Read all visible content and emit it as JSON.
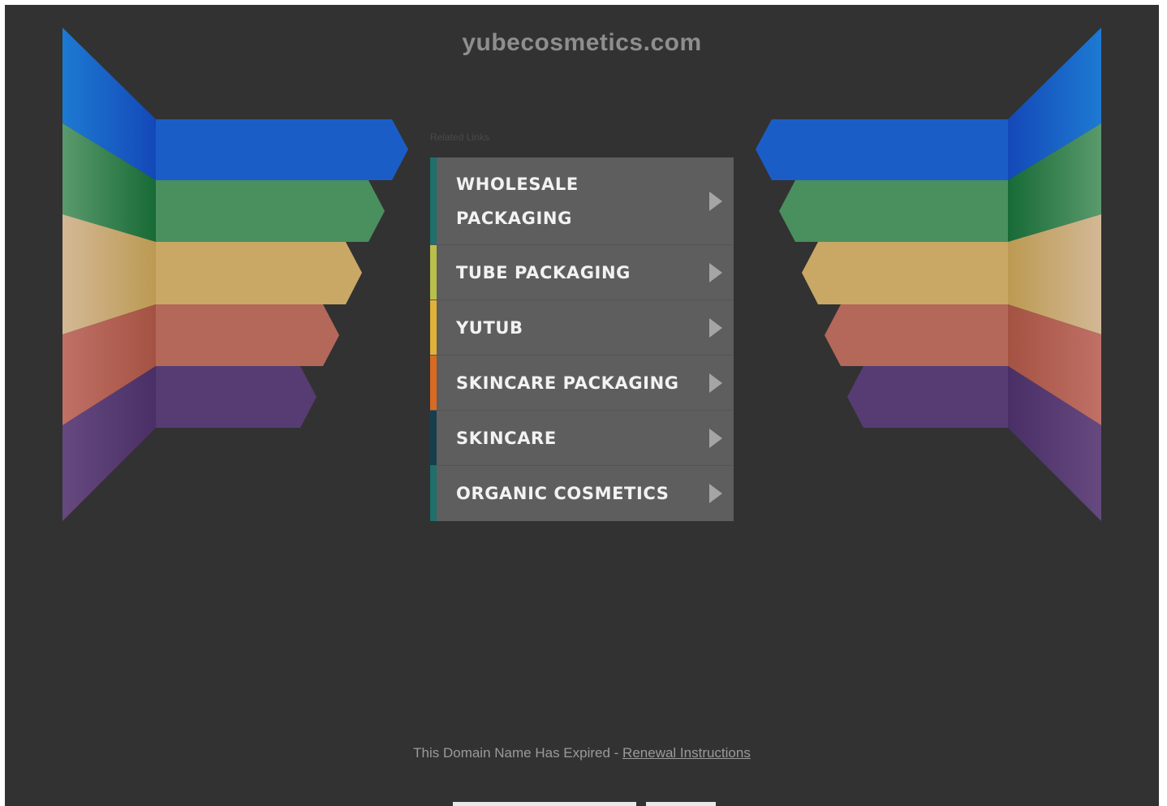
{
  "site": {
    "domain": "yubecosmetics.com"
  },
  "related": {
    "label": "Related Links"
  },
  "menu": {
    "items": [
      {
        "label_line1": "WHOLESALE",
        "label_line2": "PACKAGING",
        "accent": "#1f6f6a"
      },
      {
        "label": "TUBE PACKAGING",
        "accent": "#b8c04a"
      },
      {
        "label": "YUTUB",
        "accent": "#e0b23a"
      },
      {
        "label": "SKINCARE PACKAGING",
        "accent": "#d96a22"
      },
      {
        "label": "SKINCARE",
        "accent": "#163e4d"
      },
      {
        "label": "ORGANIC COSMETICS",
        "accent": "#1f6f6a"
      }
    ]
  },
  "footer": {
    "text": "This Domain Name Has Expired - ",
    "link": "Renewal Instructions"
  },
  "colors": {
    "background": "#323232",
    "stripes": [
      "#1c5fc4",
      "#2f7f4a",
      "#c9a464",
      "#b0604f",
      "#54396f"
    ]
  }
}
